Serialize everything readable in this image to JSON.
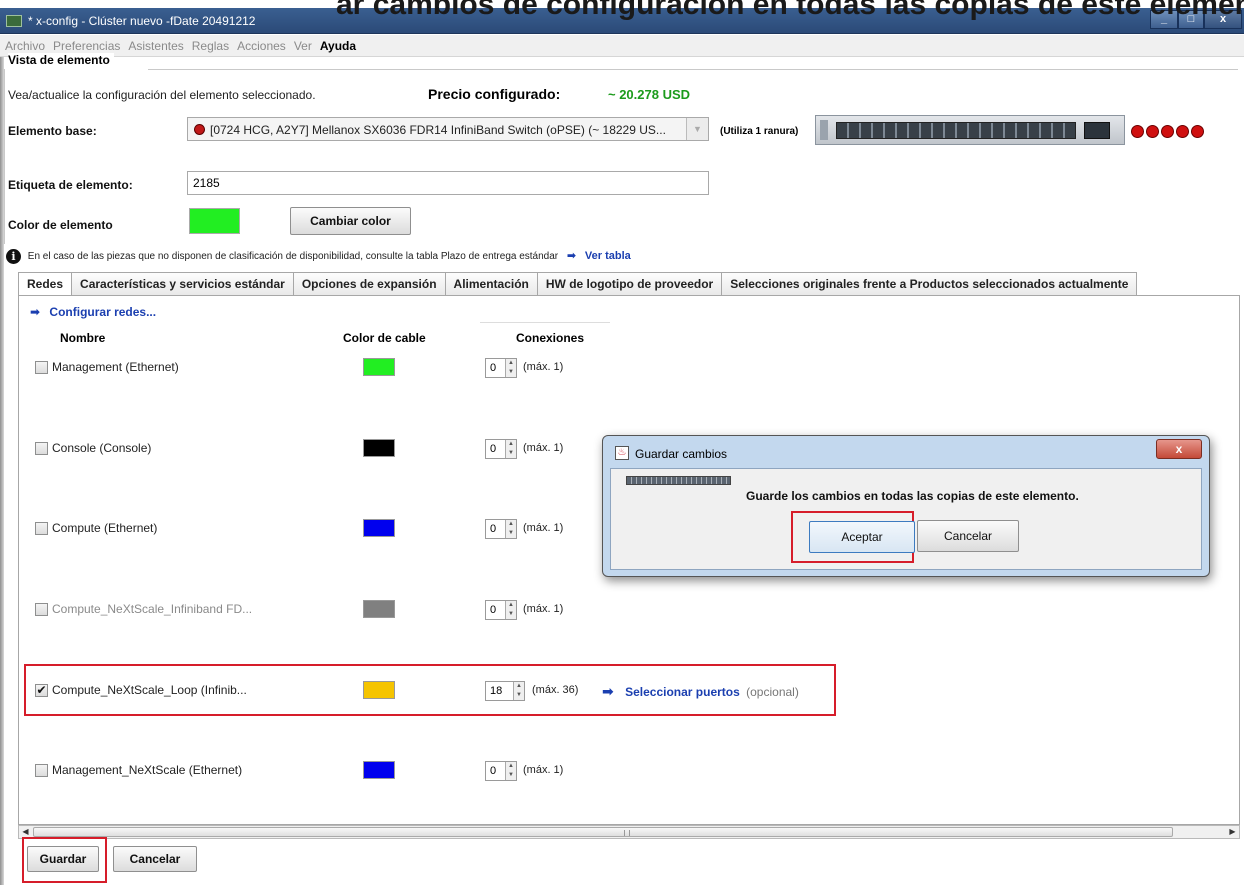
{
  "overlay_title": "ar cambios de configuración en todas las copias de este elemento",
  "window": {
    "title": "* x-config - Clúster nuevo -fDate 20491212",
    "buttons": {
      "minimize": "_",
      "maximize": "□",
      "close": "x"
    }
  },
  "menu": [
    "Archivo",
    "Preferencias",
    "Asistentes",
    "Reglas",
    "Acciones",
    "Ver",
    "Ayuda"
  ],
  "element_view": {
    "section_title": "Vista de elemento",
    "description": "Vea/actualice la configuración del elemento seleccionado.",
    "price_label": "Precio configurado:",
    "price_value": "~ 20.278 USD",
    "base_label": "Elemento base:",
    "base_value": "[0724 HCG, A2Y7] Mellanox SX6036 FDR14 InfiniBand Switch (oPSE) (~ 18229 US...",
    "slot_note": "(Utiliza 1 ranura)",
    "tag_label": "Etiqueta de elemento:",
    "tag_value": "2185",
    "color_label": "Color de elemento",
    "element_color": "#22ee22",
    "change_color": "Cambiar color"
  },
  "info": {
    "text": "En el caso de las piezas que no disponen de clasificación de disponibilidad, consulte la tabla Plazo de entrega estándar",
    "arrow": "➡",
    "link": "Ver tabla"
  },
  "tabs": [
    "Redes",
    "Características y servicios estándar",
    "Opciones de expansión",
    "Alimentación",
    "HW de logotipo de proveedor",
    "Selecciones originales frente a Productos seleccionados actualmente"
  ],
  "networks": {
    "configure_link": "Configurar redes...",
    "arrow": "➡",
    "headers": {
      "name": "Nombre",
      "cable": "Color de cable",
      "connections": "Conexiones"
    },
    "rows": [
      {
        "name": "Management (Ethernet)",
        "checked": false,
        "color": "#22ee22",
        "value": "0",
        "max": "(máx. 1)"
      },
      {
        "name": "Console (Console)",
        "checked": false,
        "color": "#000000",
        "value": "0",
        "max": "(máx. 1)"
      },
      {
        "name": "Compute (Ethernet)",
        "checked": false,
        "color": "#0000ee",
        "value": "0",
        "max": "(máx. 1)"
      },
      {
        "name": "Compute_NeXtScale_Infiniband FD...",
        "checked": false,
        "color": "#808080",
        "value": "0",
        "max": "(máx. 1)"
      },
      {
        "name": "Compute_NeXtScale_Loop (Infinib...",
        "checked": true,
        "color": "#f5c400",
        "value": "18",
        "max": "(máx. 36)",
        "select_ports": "Seleccionar puertos",
        "optional": "(opcional)"
      },
      {
        "name": "Management_NeXtScale (Ethernet)",
        "checked": false,
        "color": "#0000ee",
        "value": "0",
        "max": "(máx. 1)"
      }
    ]
  },
  "footer": {
    "save": "Guardar",
    "cancel": "Cancelar"
  },
  "dialog": {
    "title": "Guardar cambios",
    "close": "x",
    "message": "Guarde los cambios en todas las copias de este elemento.",
    "ok": "Aceptar",
    "cancel": "Cancelar"
  },
  "highlight_color": "#d61d2a"
}
